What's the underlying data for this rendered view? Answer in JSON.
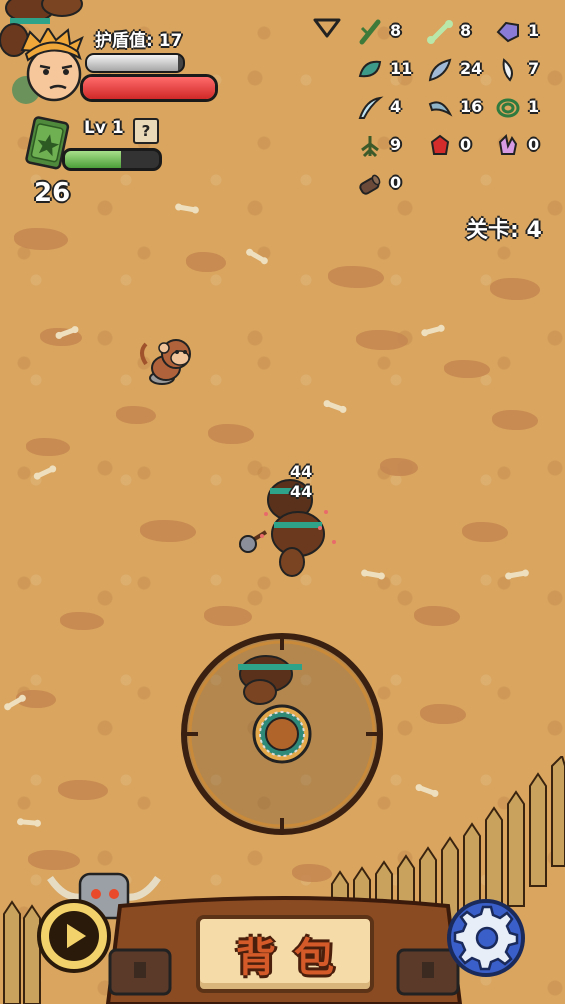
{
  "hud": {
    "shield_label": "护盾值: 17",
    "shield_fill": 0.95,
    "hp_fill": 1.0,
    "level_label": "Lv 1",
    "help_label": "?",
    "xp_fill": 0.6,
    "coin_count": "26",
    "stage_label": "关卡: 4"
  },
  "resources": [
    {
      "icon": "stick-icon",
      "count": "8",
      "color": "#3f7a3a"
    },
    {
      "icon": "bone-icon",
      "count": "8",
      "color": "#b9e7a9"
    },
    {
      "icon": "stone-icon",
      "count": "1",
      "color": "#8a7bd6"
    },
    {
      "icon": "leaf-icon",
      "count": "11",
      "color": "#3d9a88"
    },
    {
      "icon": "feather-icon",
      "count": "24",
      "color": "#9fb9d6"
    },
    {
      "icon": "fang-icon",
      "count": "7",
      "color": "#eef2f5"
    },
    {
      "icon": "claw-icon",
      "count": "4",
      "color": "#bfe3f2"
    },
    {
      "icon": "horn-icon",
      "count": "16",
      "color": "#8fb4c8"
    },
    {
      "icon": "rope-icon",
      "count": "1",
      "color": "#2f7a3e"
    },
    {
      "icon": "root-icon",
      "count": "9",
      "color": "#3c5a2a"
    },
    {
      "icon": "ruby-icon",
      "count": "0",
      "color": "#d42b2b"
    },
    {
      "icon": "crystal-icon",
      "count": "0",
      "color": "#d69be3"
    },
    {
      "icon": "log-icon",
      "count": "0",
      "color": "#6b4a3a"
    }
  ],
  "damage_numbers": [
    "44",
    "44"
  ],
  "bottom": {
    "backpack_label": "背包"
  }
}
